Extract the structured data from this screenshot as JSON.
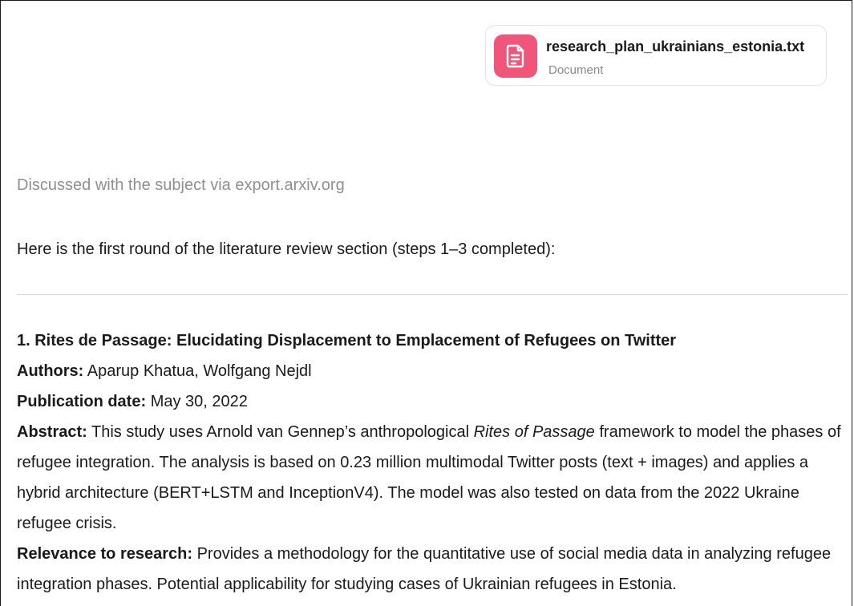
{
  "attachment": {
    "icon": "document-icon",
    "icon_color": "#f0557a",
    "filename": "research_plan_ukrainians_estonia.txt",
    "type": "Document"
  },
  "status": {
    "text": "Discussed with the subject via export.arxiv.org"
  },
  "intro": {
    "text": "Here is the first round of the literature review section (steps 1–3 completed):"
  },
  "entries": [
    {
      "title": "1. Rites de Passage: Elucidating Displacement to Emplacement of Refugees on Twitter",
      "authors_label": "Authors:",
      "authors": "Aparup Khatua, Wolfgang Nejdl",
      "date_label": "Publication date:",
      "date": "May 30, 2022",
      "abstract_label": "Abstract:",
      "abstract_before": "This study uses Arnold van Gennep’s anthropological",
      "abstract_italic": "Rites of Passage",
      "abstract_after": "framework to model the phases of refugee integration. The analysis is based on 0.23 million multimodal Twitter posts (text + images) and applies a hybrid architecture (BERT+LSTM and InceptionV4). The model was also tested on data from the 2022 Ukraine refugee crisis.",
      "relevance_label": "Relevance to research:",
      "relevance": "Provides a methodology for the quantitative use of social media data in analyzing refugee integration phases. Potential applicability for studying cases of Ukrainian refugees in Estonia."
    }
  ]
}
